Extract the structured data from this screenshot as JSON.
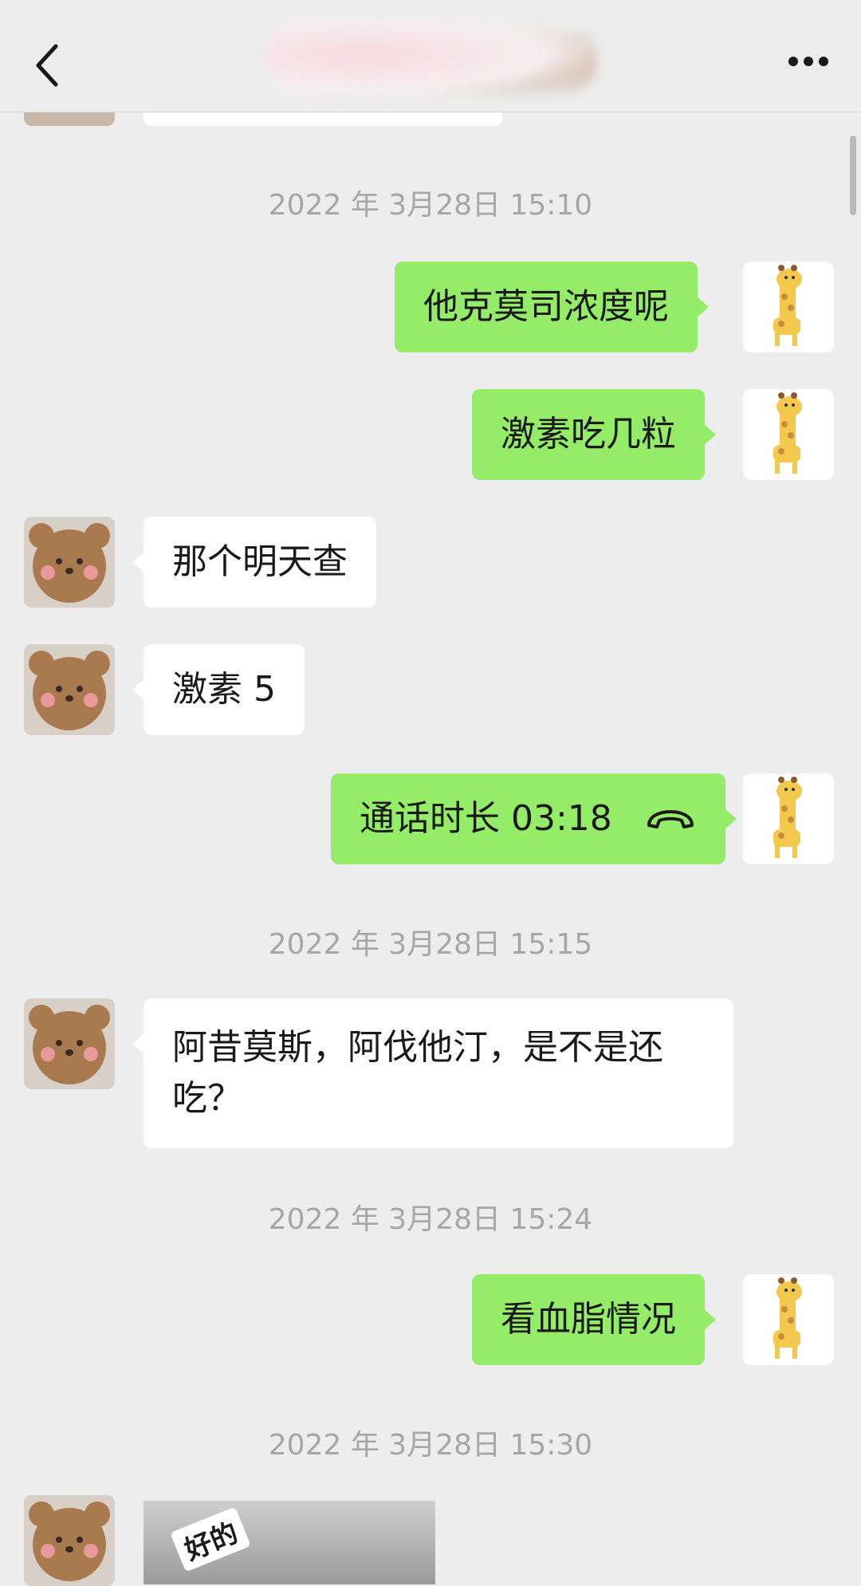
{
  "header": {
    "title_blurred": "",
    "back_icon": "chevron-left-icon",
    "more_icon": "ellipsis-icon"
  },
  "messages": [
    {
      "kind": "timestamp",
      "text": "2022 年 3月28日 15:10"
    },
    {
      "kind": "out",
      "text": "他克莫司浓度呢"
    },
    {
      "kind": "out",
      "text": "激素吃几粒"
    },
    {
      "kind": "in",
      "text": "那个明天查"
    },
    {
      "kind": "in",
      "text": "激素 5"
    },
    {
      "kind": "out-call",
      "text": "通话时长 03:18",
      "icon": "phone-hangup-icon"
    },
    {
      "kind": "timestamp",
      "text": "2022 年 3月28日 15:15"
    },
    {
      "kind": "in",
      "text": "阿昔莫斯，阿伐他汀，是不是还吃？"
    },
    {
      "kind": "timestamp",
      "text": "2022 年 3月28日 15:24"
    },
    {
      "kind": "out",
      "text": "看血脂情况"
    },
    {
      "kind": "timestamp",
      "text": "2022 年 3月28日 15:30"
    },
    {
      "kind": "in-image",
      "caption": "好的"
    }
  ],
  "colors": {
    "background": "#ededed",
    "outgoing_bubble": "#95ec69",
    "incoming_bubble": "#ffffff",
    "timestamp_text": "#a6a6a6"
  },
  "avatars": {
    "self": "giraffe-avatar",
    "other": "bear-avatar"
  }
}
